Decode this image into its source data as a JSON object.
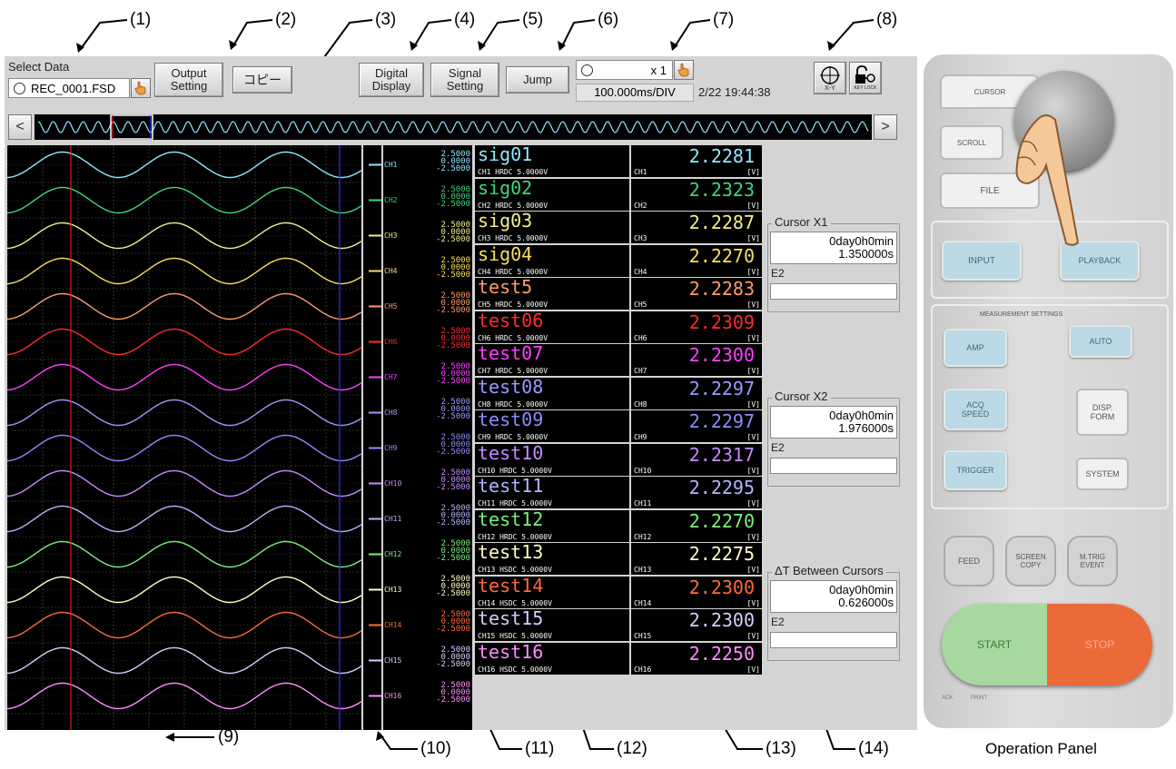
{
  "callouts": [
    "(1)",
    "(2)",
    "(3)",
    "(4)",
    "(5)",
    "(6)",
    "(7)",
    "(8)",
    "(9)",
    "(10)",
    "(11)",
    "(12)",
    "(13)",
    "(14)"
  ],
  "panel_caption": "Operation Panel",
  "toolbar": {
    "select_data_label": "Select Data",
    "file_name": "REC_0001.FSD",
    "output_setting": "Output\nSetting",
    "copy": "コピー",
    "digital_display": "Digital\nDisplay",
    "signal_setting": "Signal\nSetting",
    "jump": "Jump",
    "zoom": "x 1",
    "time_div": "100.000ms/DIV",
    "datetime": "2/22 19:44:38",
    "xy_label": "X-Y",
    "keylock_label": "KEY LOCK"
  },
  "nav": {
    "prev": "<",
    "next": ">"
  },
  "channels": [
    {
      "ch": "CH1",
      "name": "sig01",
      "range": "CH1 HRDC  5.0000V",
      "value": "2.2281",
      "color": "#8fe8ff"
    },
    {
      "ch": "CH2",
      "name": "sig02",
      "range": "CH2 HRDC  5.0000V",
      "value": "2.2323",
      "color": "#3ed67c"
    },
    {
      "ch": "CH3",
      "name": "sig03",
      "range": "CH3 HRDC  5.0000V",
      "value": "2.2287",
      "color": "#f2f08a"
    },
    {
      "ch": "CH4",
      "name": "sig04",
      "range": "CH4 HRDC  5.0000V",
      "value": "2.2270",
      "color": "#f6e05a"
    },
    {
      "ch": "CH5",
      "name": "test5",
      "range": "CH5 HRDC  5.0000V",
      "value": "2.2283",
      "color": "#ff9a6a"
    },
    {
      "ch": "CH6",
      "name": "test06",
      "range": "CH6 HRDC  5.0000V",
      "value": "2.2309",
      "color": "#ff2a2a"
    },
    {
      "ch": "CH7",
      "name": "test07",
      "range": "CH7 HRDC  5.0000V",
      "value": "2.2300",
      "color": "#ff40ff"
    },
    {
      "ch": "CH8",
      "name": "test08",
      "range": "CH8 HRDC  5.0000V",
      "value": "2.2297",
      "color": "#9a9aff"
    },
    {
      "ch": "CH9",
      "name": "test09",
      "range": "CH9 HRDC  5.0000V",
      "value": "2.2297",
      "color": "#8c8cff"
    },
    {
      "ch": "CH10",
      "name": "test10",
      "range": "CH10 HRDC  5.0000V",
      "value": "2.2317",
      "color": "#c48cff"
    },
    {
      "ch": "CH11",
      "name": "test11",
      "range": "CH11 HRDC  5.0000V",
      "value": "2.2295",
      "color": "#b4b4ff"
    },
    {
      "ch": "CH12",
      "name": "test12",
      "range": "CH12 HRDC  5.0000V",
      "value": "2.2270",
      "color": "#7cf07c"
    },
    {
      "ch": "CH13",
      "name": "test13",
      "range": "CH13 HSDC  5.0000V",
      "value": "2.2275",
      "color": "#ffffc8"
    },
    {
      "ch": "CH14",
      "name": "test14",
      "range": "CH14 HSDC  5.0000V",
      "value": "2.2300",
      "color": "#ff6a3a"
    },
    {
      "ch": "CH15",
      "name": "test15",
      "range": "CH15 HSDC  5.0000V",
      "value": "2.2300",
      "color": "#d0d0ff"
    },
    {
      "ch": "CH16",
      "name": "test16",
      "range": "CH16 HSDC  5.0000V",
      "value": "2.2250",
      "color": "#ff8cff"
    }
  ],
  "scale": {
    "top": "2.5000",
    "mid": "0.0000",
    "bottom": "-2.5000"
  },
  "unit": "[V]",
  "cursor_x1": {
    "label": "Cursor X1",
    "line1": "0day0h0min",
    "line2": "1.350000s",
    "e2": "E2"
  },
  "cursor_x2": {
    "label": "Cursor X2",
    "line1": "0day0h0min",
    "line2": "1.976000s",
    "e2": "E2"
  },
  "delta": {
    "label": "ΔT Between Cursors",
    "line1": "0day0h0min",
    "line2": "0.626000s",
    "e2": "E2"
  },
  "operation_panel": {
    "cursor": "CURSOR",
    "scroll": "SCROLL",
    "file": "FILE",
    "input": "INPUT",
    "playback": "PLAYBACK",
    "measurement": "MEASUREMENT SETTINGS",
    "amp": "AMP",
    "auto": "AUTO",
    "acq": "ACQ\nSPEED",
    "disp": "DISP.\nFORM",
    "trigger": "TRIGGER",
    "system": "SYSTEM",
    "feed": "FEED",
    "screen_copy": "SCREEN\nCOPY",
    "m_trig": "M.TRIG\nEVENT",
    "start": "START",
    "stop": "STOP",
    "legend1": "ACK",
    "legend2": "PRINT"
  }
}
